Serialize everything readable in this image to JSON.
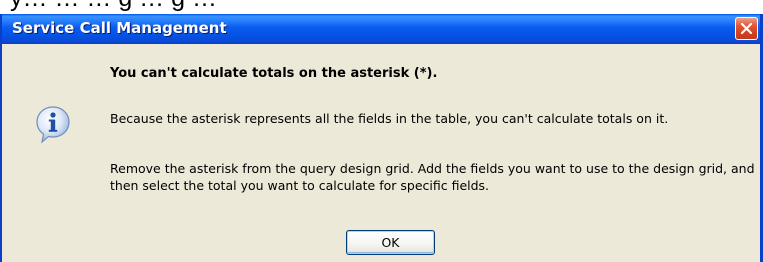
{
  "background_text": "y… … … g … g …",
  "window": {
    "title": "Service Call Management"
  },
  "message": {
    "heading": "You can't calculate totals on the asterisk (*).",
    "paragraph1": "Because the asterisk represents all the fields in the table, you can't calculate totals on it.",
    "paragraph2": "Remove the asterisk from the query design grid. Add the fields you want to use to the design grid, and then select the total you want to calculate for specific fields."
  },
  "buttons": {
    "ok_label": "OK"
  },
  "icons": {
    "info": "info-icon",
    "close": "close-icon"
  },
  "colors": {
    "titlebar": "#0a5cf0",
    "dialog_background": "#ece9d8",
    "close_button": "#d1411f"
  }
}
